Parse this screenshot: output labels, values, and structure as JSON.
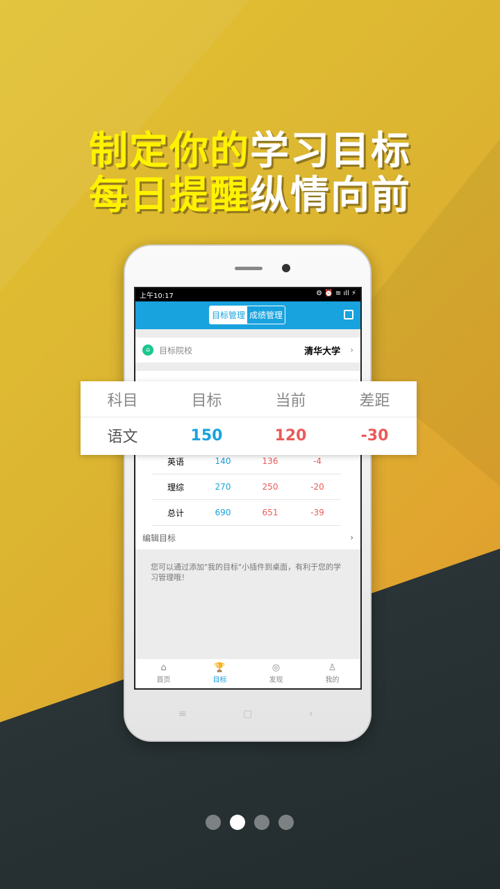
{
  "headline": {
    "line1a": "制定你的",
    "line1b": "学习目标",
    "line2a": "每日提醒",
    "line2b": "纵情向前"
  },
  "status": {
    "time": "上午10:17",
    "icons": "⚙ ⏰ ≋ ıll ⚡"
  },
  "appbar": {
    "tab_goal": "目标管理",
    "tab_score": "成绩管理",
    "share_icon": "share-icon"
  },
  "school": {
    "label": "目标院校",
    "value": "清华大学",
    "icon": "⌂"
  },
  "card": {
    "headers": [
      "科目",
      "目标",
      "当前",
      "差距"
    ],
    "row": [
      "语文",
      "150",
      "120",
      "-30"
    ]
  },
  "rows": [
    [
      "英语",
      "140",
      "136",
      "-4"
    ],
    [
      "理综",
      "270",
      "250",
      "-20"
    ],
    [
      "总计",
      "690",
      "651",
      "-39"
    ]
  ],
  "edit_label": "编辑目标",
  "tip": "您可以通过添加\"我的目标\"小插件到桌面，有利于您的学习管理哦！",
  "tabs": [
    {
      "label": "首页",
      "icon": "⌂"
    },
    {
      "label": "目标",
      "icon": "🏆"
    },
    {
      "label": "发现",
      "icon": "◎"
    },
    {
      "label": "我的",
      "icon": "♙"
    }
  ],
  "nav": {
    "menu": "≡",
    "home": "▢",
    "back": "‹"
  },
  "pager": {
    "count": 4,
    "active": 2
  },
  "colors": {
    "accent": "#18a2de",
    "red": "#ea5a5a",
    "green": "#1cc78f"
  }
}
